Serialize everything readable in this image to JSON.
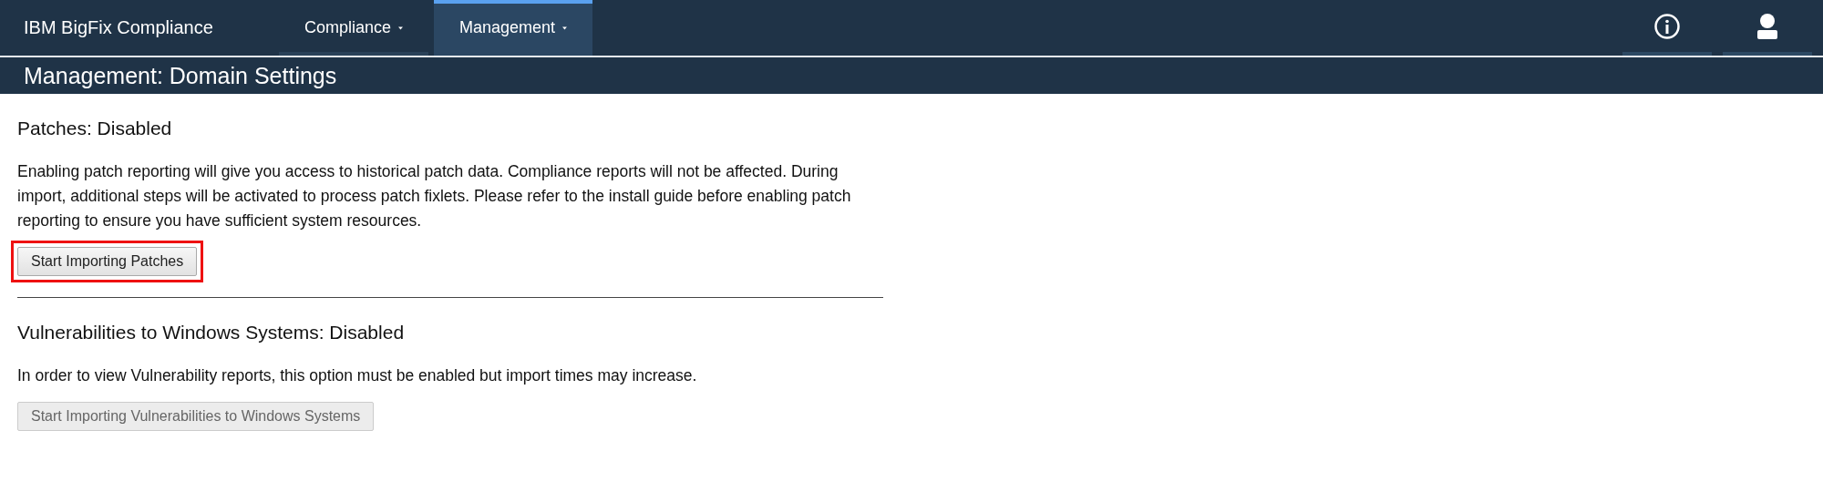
{
  "app": {
    "brand": "IBM BigFix Compliance"
  },
  "nav": [
    {
      "label": "Compliance",
      "selected": false
    },
    {
      "label": "Management",
      "selected": true
    }
  ],
  "page_title": "Management: Domain Settings",
  "sections": [
    {
      "heading": "Patches: Disabled",
      "description": "Enabling patch reporting will give you access to historical patch data. Compliance reports will not be affected. During import, additional steps will be activated to process patch fixlets. Please refer to the install guide before enabling patch reporting to ensure you have sufficient system resources.",
      "button": {
        "label": "Start Importing Patches",
        "disabled": false,
        "highlighted": true
      }
    },
    {
      "heading": "Vulnerabilities to Windows Systems: Disabled",
      "description": "In order to view Vulnerability reports, this option must be enabled but import times may increase.",
      "button": {
        "label": "Start Importing Vulnerabilities to Windows Systems",
        "disabled": true,
        "highlighted": false
      }
    }
  ]
}
